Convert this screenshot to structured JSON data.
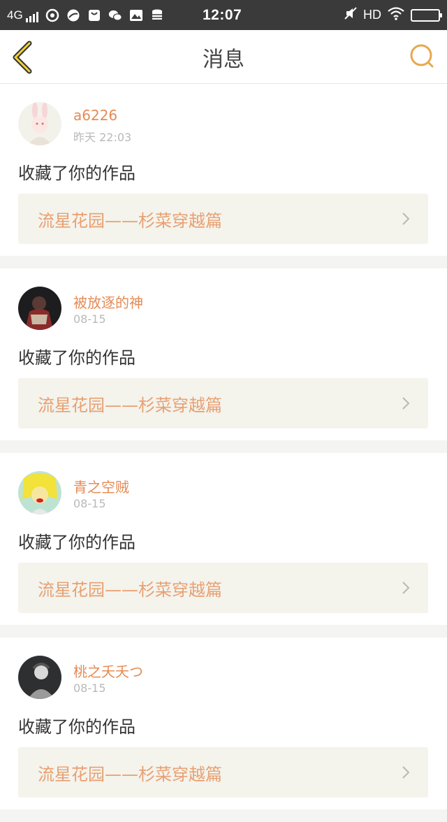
{
  "status_bar": {
    "network": "4G",
    "time": "12:07",
    "hd": "HD"
  },
  "header": {
    "title": "消息",
    "accent": "#e8a84c"
  },
  "messages": [
    {
      "username": "a6226",
      "time": "昨天 22:03",
      "action": "收藏了你的作品",
      "work_title": "流星花园——杉菜穿越篇"
    },
    {
      "username": "被放逐的神",
      "time": "08-15",
      "action": "收藏了你的作品",
      "work_title": "流星花园——杉菜穿越篇"
    },
    {
      "username": "青之空贼",
      "time": "08-15",
      "action": "收藏了你的作品",
      "work_title": "流星花园——杉菜穿越篇"
    },
    {
      "username": "桃之夭夭つ",
      "time": "08-15",
      "action": "收藏了你的作品",
      "work_title": "流星花园——杉菜穿越篇"
    }
  ]
}
